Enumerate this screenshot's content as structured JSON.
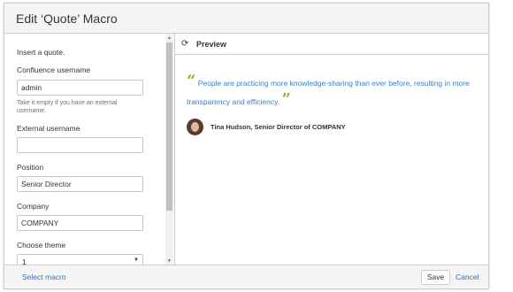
{
  "dialog": {
    "title": "Edit ‘Quote’ Macro"
  },
  "form": {
    "intro": "Insert a quote.",
    "confluence_username_label": "Confluence username",
    "confluence_username_value": "admin",
    "confluence_username_help": "Take it empty if you have an external username.",
    "external_username_label": "External username",
    "external_username_value": "",
    "position_label": "Position",
    "position_value": "Senior Director",
    "company_label": "Company",
    "company_value": "COMPANY",
    "theme_label": "Choose theme",
    "theme_value": "1"
  },
  "preview": {
    "title": "Preview",
    "open_quote": "“",
    "close_quote": "”",
    "quote_text": "People are practicing more knowledge-sharing than ever before, resulting in more transparency and efficiency.",
    "author": "Tina Hudson, Senior Director of COMPANY"
  },
  "footer": {
    "select_macro": "Select macro",
    "save": "Save",
    "cancel": "Cancel"
  },
  "icons": {
    "refresh": "refresh-icon",
    "dropdown": "chevron-down-icon"
  },
  "colors": {
    "link": "#3572b0",
    "quote_text": "#3b7fc4",
    "quote_mark": "#8ab52e"
  }
}
